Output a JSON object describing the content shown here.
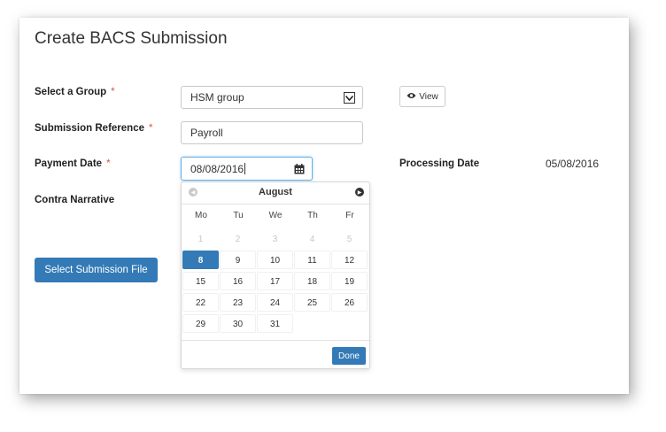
{
  "form": {
    "title": "Create BACS Submission",
    "group_label": "Select a Group",
    "group_value": "HSM group",
    "view_label": "View",
    "reference_label": "Submission Reference",
    "reference_value": "Payroll",
    "payment_date_label": "Payment Date",
    "payment_date_value": "08/08/2016",
    "processing_date_label": "Processing Date",
    "processing_date_value": "05/08/2016",
    "contra_label": "Contra Narrative",
    "select_file_label": "Select Submission File",
    "required_mark": "*"
  },
  "datepicker": {
    "month": "August",
    "weekdays": [
      "Mo",
      "Tu",
      "We",
      "Th",
      "Fr"
    ],
    "weeks": [
      [
        {
          "d": "1",
          "m": true
        },
        {
          "d": "2",
          "m": true
        },
        {
          "d": "3",
          "m": true
        },
        {
          "d": "4",
          "m": true
        },
        {
          "d": "5",
          "m": true
        }
      ],
      [
        {
          "d": "8",
          "a": true
        },
        {
          "d": "9"
        },
        {
          "d": "10"
        },
        {
          "d": "11"
        },
        {
          "d": "12"
        }
      ],
      [
        {
          "d": "15"
        },
        {
          "d": "16"
        },
        {
          "d": "17"
        },
        {
          "d": "18"
        },
        {
          "d": "19"
        }
      ],
      [
        {
          "d": "22"
        },
        {
          "d": "23"
        },
        {
          "d": "24"
        },
        {
          "d": "25"
        },
        {
          "d": "26"
        }
      ],
      [
        {
          "d": "29"
        },
        {
          "d": "30"
        },
        {
          "d": "31"
        }
      ]
    ],
    "done_label": "Done"
  },
  "icons": {
    "view": "eye-icon",
    "calendar": "calendar-icon",
    "select": "chevron-down-icon",
    "prev": "chevron-left-icon",
    "next": "chevron-right-icon"
  },
  "colors": {
    "primary": "#337ab7",
    "required": "#d9534f",
    "focus": "#66afe9"
  }
}
